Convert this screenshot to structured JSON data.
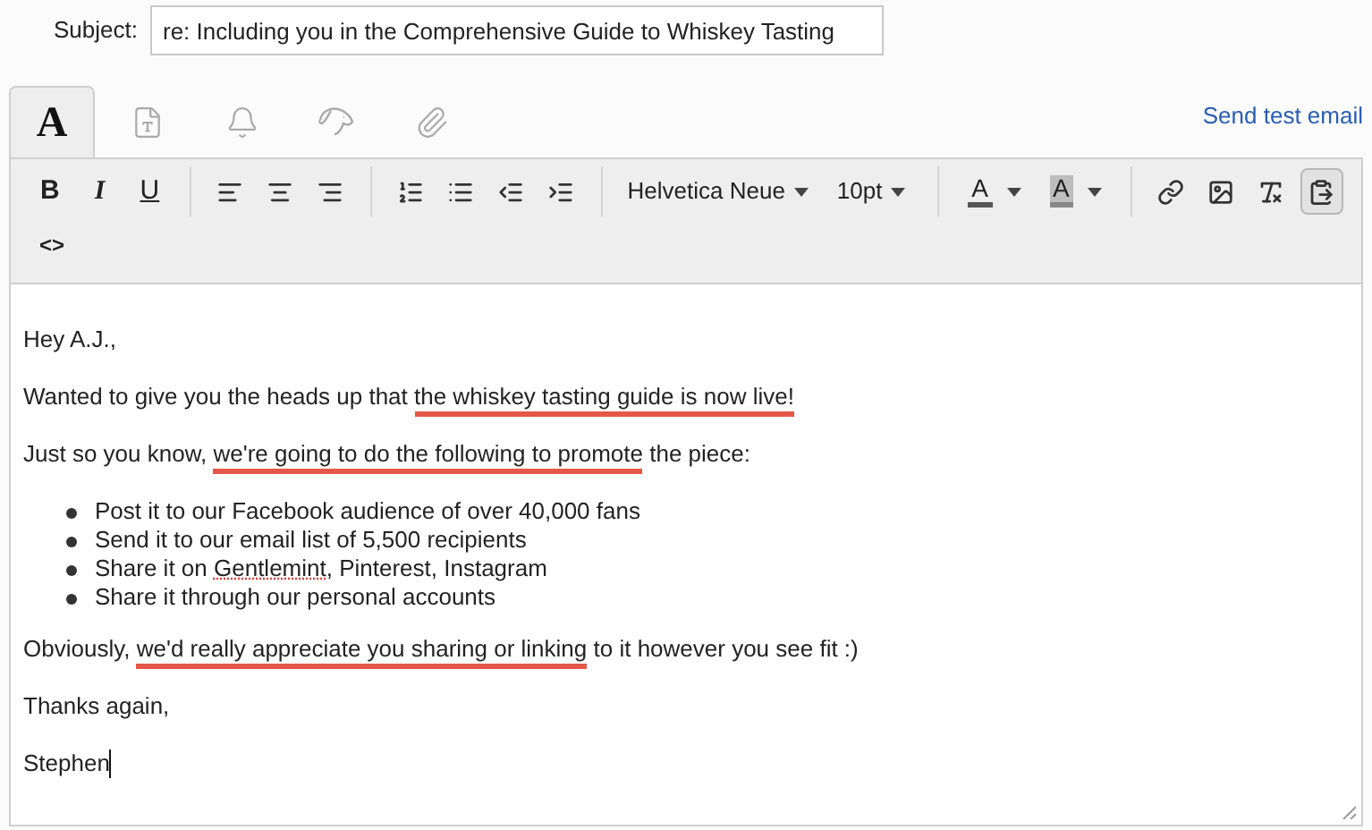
{
  "subject": {
    "label": "Subject:",
    "value": "re: Including you in the Comprehensive Guide to Whiskey Tasting"
  },
  "tabs": [
    {
      "kind": "text",
      "label": "A",
      "selected": true
    },
    {
      "kind": "template",
      "selected": false
    },
    {
      "kind": "bell",
      "selected": false
    },
    {
      "kind": "dog",
      "selected": false
    },
    {
      "kind": "attachment",
      "selected": false
    }
  ],
  "send_test_link": "Send test email",
  "toolbar": {
    "style_buttons": [
      {
        "kind": "bold",
        "label": "B",
        "active": false
      },
      {
        "kind": "italic",
        "label": "I",
        "active": false
      },
      {
        "kind": "underline",
        "label": "U",
        "active": false
      }
    ],
    "align_buttons": [
      {
        "kind": "left",
        "active": false
      },
      {
        "kind": "center",
        "active": false
      },
      {
        "kind": "right",
        "active": false
      }
    ],
    "list_buttons": [
      {
        "kind": "ordered",
        "active": false
      },
      {
        "kind": "bullet",
        "active": false
      },
      {
        "kind": "outdent",
        "active": false
      },
      {
        "kind": "indent",
        "active": false
      }
    ],
    "font": "Helvetica Neue",
    "size": "10pt",
    "text_color": {
      "label": "A"
    },
    "highlight_color": {
      "label": "A"
    },
    "insert_buttons": [
      {
        "kind": "link",
        "active": false
      },
      {
        "kind": "image",
        "active": false
      },
      {
        "kind": "clear",
        "active": false
      },
      {
        "kind": "paste",
        "active": true
      }
    ],
    "source_button": "<>"
  },
  "body": [
    {
      "kind": "paragraph",
      "segments": [
        {
          "text": "Hey A.J.,"
        }
      ]
    },
    {
      "kind": "paragraph",
      "segments": [
        {
          "text": "Wanted to give you the heads up that "
        },
        {
          "text": "the whiskey tasting guide is now live!",
          "underlined": true
        }
      ]
    },
    {
      "kind": "paragraph",
      "segments": [
        {
          "text": "Just so you know, "
        },
        {
          "text": "we're going to do the following to promote",
          "underlined": true
        },
        {
          "text": " the piece:"
        }
      ]
    },
    {
      "kind": "list",
      "items": [
        [
          {
            "text": "Post it to our Facebook audience of over 40,000 fans"
          }
        ],
        [
          {
            "text": "Send it to our email list of 5,500 recipients"
          }
        ],
        [
          {
            "text": "Share it on "
          },
          {
            "text": "Gentlemint",
            "misspelled": true
          },
          {
            "text": ", Pinterest, Instagram"
          }
        ],
        [
          {
            "text": "Share it through our personal accounts"
          }
        ]
      ]
    },
    {
      "kind": "paragraph",
      "segments": [
        {
          "text": "Obviously, "
        },
        {
          "text": "we'd really appreciate you sharing or linking",
          "underlined": true
        },
        {
          "text": " to it however you see fit :)"
        }
      ]
    },
    {
      "kind": "paragraph",
      "segments": [
        {
          "text": "Thanks again,"
        }
      ]
    },
    {
      "kind": "paragraph",
      "cursor": true,
      "segments": [
        {
          "text": "Stephen"
        }
      ]
    }
  ]
}
